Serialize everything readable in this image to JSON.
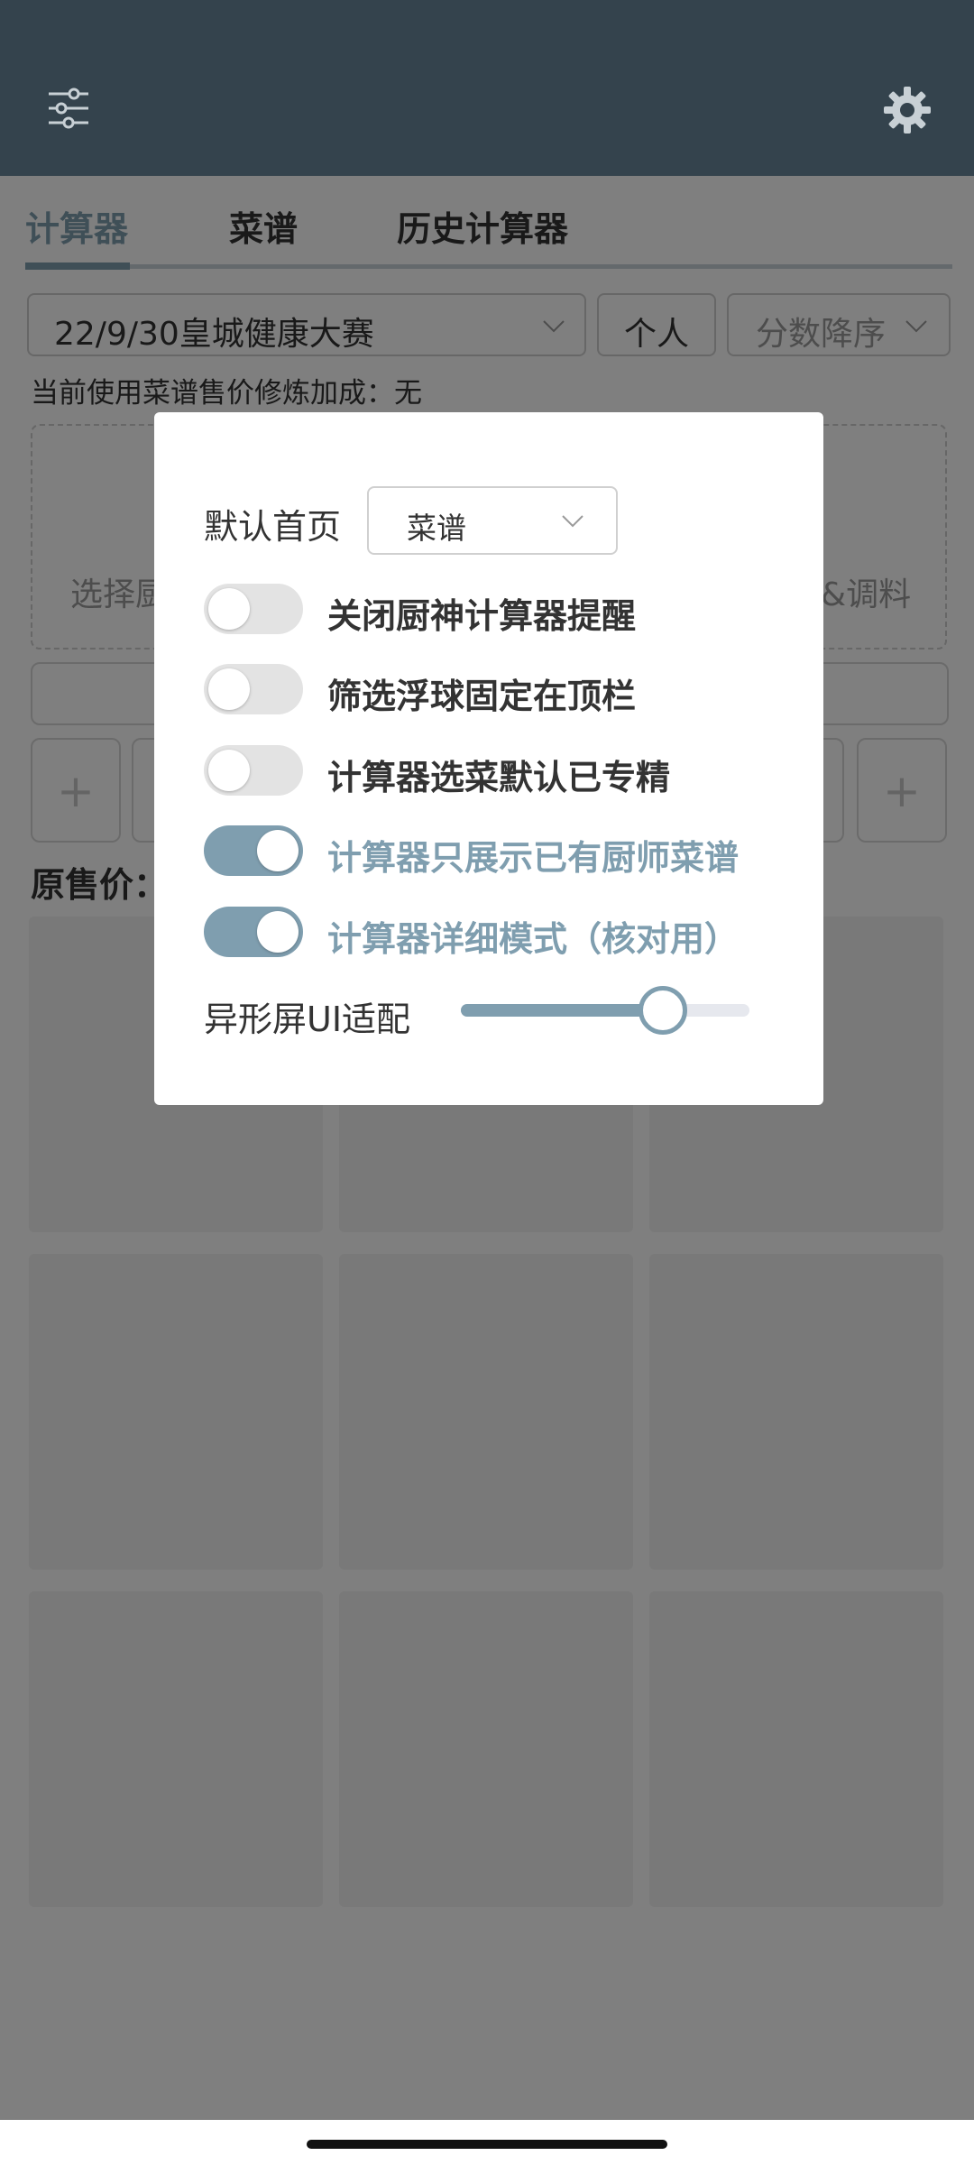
{
  "header": {
    "left_icon": "sliders-filter-icon",
    "right_icon": "gear-icon"
  },
  "tabs": [
    {
      "label": "计算器",
      "active": true
    },
    {
      "label": "菜谱",
      "active": false
    },
    {
      "label": "历史计算器",
      "active": false
    }
  ],
  "filters": {
    "contest_select": "22/9/30皇城健康大赛",
    "personal_button": "个人",
    "sort_select": "分数降序"
  },
  "info_line": "当前使用菜谱售价修炼加成：无",
  "slots": {
    "left_label": "选择厨",
    "right_label": "&调料"
  },
  "original_price_label": "原售价：",
  "dialog": {
    "default_home_label": "默认首页",
    "default_home_value": "菜谱",
    "toggles": [
      {
        "label": "关闭厨神计算器提醒",
        "on": false
      },
      {
        "label": "筛选浮球固定在顶栏",
        "on": false
      },
      {
        "label": "计算器选菜默认已专精",
        "on": false
      },
      {
        "label": "计算器只展示已有厨师菜谱",
        "on": true
      },
      {
        "label": "计算器详细模式（核对用）",
        "on": true
      }
    ],
    "slider_label": "异形屏UI适配",
    "slider_value": 0.7
  },
  "colors": {
    "header": "#34434d",
    "accent": "#7f9eaf"
  }
}
